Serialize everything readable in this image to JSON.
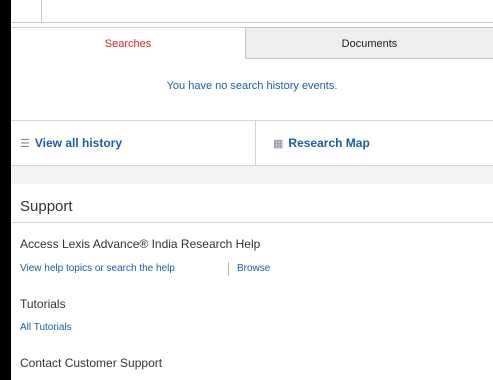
{
  "tabs": {
    "searches": "Searches",
    "documents": "Documents"
  },
  "history": {
    "empty_message": "You have no search history events.",
    "view_all_label": "View all history",
    "research_map_label": "Research Map"
  },
  "support": {
    "title": "Support",
    "help": {
      "title": "Access Lexis Advance® India Research Help",
      "view_topics_link": "View help topics or search the help",
      "browse_link": "Browse"
    },
    "tutorials": {
      "title": "Tutorials",
      "all_link": "All Tutorials"
    },
    "contact": {
      "title": "Contact Customer Support"
    }
  },
  "icons": {
    "list": "list-icon",
    "map": "research-map-icon"
  },
  "colors": {
    "active_tab_text": "#d9261c",
    "link": "#1a5fa8",
    "inactive_tab_bg": "#eeeeee"
  }
}
